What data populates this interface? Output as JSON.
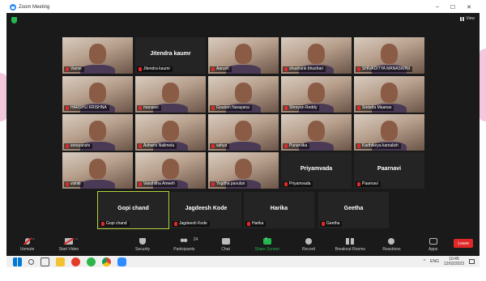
{
  "window": {
    "title": "Zoom Meeting",
    "controls": [
      "–",
      "☐",
      "✕"
    ]
  },
  "view_label": "View",
  "participants": [
    {
      "name": "Vamsi",
      "type": "video",
      "row": 0,
      "col": 0
    },
    {
      "name": "Jitendra kaumr",
      "type": "name-only",
      "label": "Jitendra kaumr",
      "row": 0,
      "col": 1
    },
    {
      "name": "Aarush",
      "type": "video",
      "row": 0,
      "col": 2
    },
    {
      "name": "shashank bhushan",
      "type": "video",
      "row": 0,
      "col": 3
    },
    {
      "name": "SHIVADITYA MANASWINI",
      "type": "video",
      "row": 0,
      "col": 4
    },
    {
      "name": "HARSHU KRISHNA",
      "type": "video",
      "row": 1,
      "col": 0
    },
    {
      "name": "manasvi",
      "type": "video",
      "row": 1,
      "col": 1
    },
    {
      "name": "Goutam Narayana",
      "type": "video",
      "row": 1,
      "col": 2
    },
    {
      "name": "Shreyan Reddy",
      "type": "video",
      "row": 1,
      "col": 3
    },
    {
      "name": "Sridatta Maanas",
      "type": "video",
      "row": 1,
      "col": 4
    },
    {
      "name": "sreeyanshi",
      "type": "video",
      "row": 2,
      "col": 0
    },
    {
      "name": "Ashwini Nalimela",
      "type": "video",
      "row": 2,
      "col": 1
    },
    {
      "name": "sahya",
      "type": "video",
      "row": 2,
      "col": 2
    },
    {
      "name": "Punarvika",
      "type": "video",
      "row": 2,
      "col": 3
    },
    {
      "name": "Karthikeya kamalish",
      "type": "video",
      "row": 2,
      "col": 4
    },
    {
      "name": "vishiti",
      "type": "video",
      "row": 3,
      "col": 0
    },
    {
      "name": "Vanshitha Ameeh",
      "type": "video",
      "row": 3,
      "col": 1
    },
    {
      "name": "Yogitha pavulun",
      "type": "video",
      "row": 3,
      "col": 2
    },
    {
      "name": "Priyamvada",
      "type": "name-only",
      "label": "Priyamvada",
      "row": 3,
      "col": 3
    },
    {
      "name": "Paarnavi",
      "type": "name-only",
      "label": "Paarnavi",
      "row": 3,
      "col": 4
    },
    {
      "name": "Gopi chand",
      "type": "name-only",
      "label": "Gopi chand",
      "row": 4,
      "col": 0,
      "active": true
    },
    {
      "name": "Jagdeesh Kode",
      "type": "name-only",
      "label": "Jagdeesh Kode",
      "row": 4,
      "col": 1
    },
    {
      "name": "Harika",
      "type": "name-only",
      "label": "Harika",
      "row": 4,
      "col": 2
    },
    {
      "name": "Geetha",
      "type": "name-only",
      "label": "Geetha",
      "row": 4,
      "col": 3
    }
  ],
  "toolbar": {
    "unmute": "Unmute",
    "start_video": "Start Video",
    "security": "Security",
    "participants": "Participants",
    "participants_count": "24",
    "chat": "Chat",
    "share_screen": "Share Screen",
    "record": "Record",
    "breakout_rooms": "Breakout Rooms",
    "reactions": "Reactions",
    "apps": "Apps",
    "leave": "Leave"
  },
  "taskbar": {
    "lang": "ENG",
    "time": "10:45",
    "date": "12/02/2023",
    "tray_caret": "^"
  },
  "colors": {
    "accent_green": "#23b74f",
    "leave_red": "#e02828",
    "active_outline": "#b4d33a",
    "zoom_blue": "#2d8cff"
  }
}
